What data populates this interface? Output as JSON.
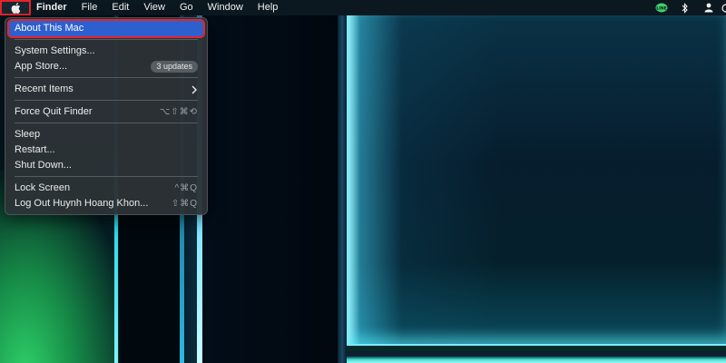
{
  "menubar": {
    "apple_icon": "apple-logo-icon",
    "items": [
      {
        "label": "Finder"
      },
      {
        "label": "File"
      },
      {
        "label": "Edit"
      },
      {
        "label": "View"
      },
      {
        "label": "Go"
      },
      {
        "label": "Window"
      },
      {
        "label": "Help"
      }
    ],
    "status_icons": [
      "line-app-icon",
      "bluetooth-icon",
      "user-icon"
    ]
  },
  "apple_menu": {
    "about": "About This Mac",
    "system_settings": "System Settings...",
    "app_store": "App Store...",
    "app_store_badge": "3 updates",
    "recent_items": "Recent Items",
    "force_quit": "Force Quit Finder",
    "force_quit_shortcut": "⌥⇧⌘⟲",
    "sleep": "Sleep",
    "restart": "Restart...",
    "shut_down": "Shut Down...",
    "lock_screen": "Lock Screen",
    "lock_screen_shortcut": "^⌘Q",
    "log_out": "Log Out Huynh Hoang Khon...",
    "log_out_shortcut": "⇧⌘Q"
  },
  "colors": {
    "highlight": "#2d5fce",
    "annotation_border": "#e5242b",
    "menubar_bg": "#0c1820",
    "menu_bg": "#2c3236"
  }
}
